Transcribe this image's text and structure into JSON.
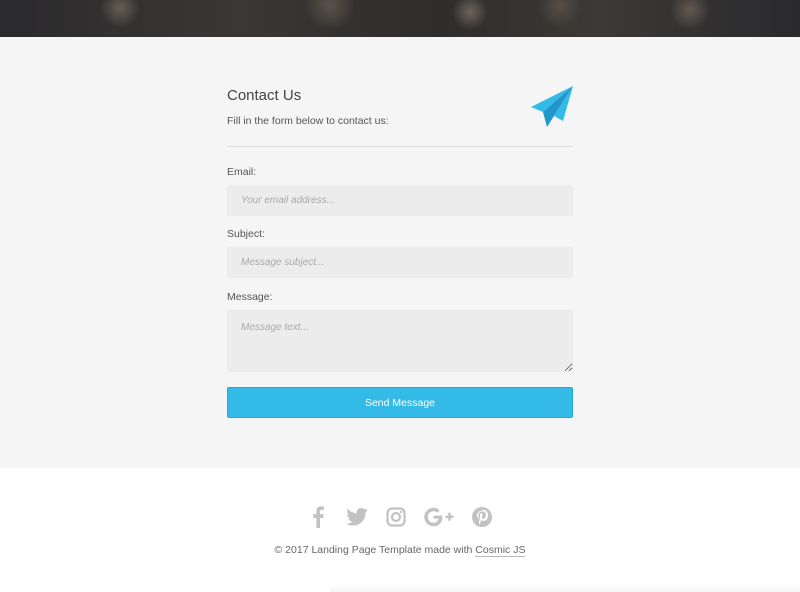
{
  "contact": {
    "title": "Contact Us",
    "subtitle": "Fill in the form below to contact us:",
    "email_label": "Email:",
    "email_placeholder": "Your email address...",
    "email_value": "",
    "subject_label": "Subject:",
    "subject_placeholder": "Message subject...",
    "subject_value": "",
    "message_label": "Message:",
    "message_placeholder": "Message text...",
    "message_value": "",
    "send_label": "Send Message",
    "icon": "paper-plane-icon"
  },
  "footer": {
    "social": [
      {
        "name": "facebook-icon"
      },
      {
        "name": "twitter-icon"
      },
      {
        "name": "instagram-icon"
      },
      {
        "name": "google-plus-icon"
      },
      {
        "name": "pinterest-icon"
      }
    ],
    "credit_text": "© 2017 Landing Page Template made with ",
    "credit_link": "Cosmic JS"
  },
  "colors": {
    "accent": "#34bae6",
    "section_bg": "#f5f5f5",
    "input_bg": "#ececec",
    "icon_gray": "#c2c2c2"
  }
}
